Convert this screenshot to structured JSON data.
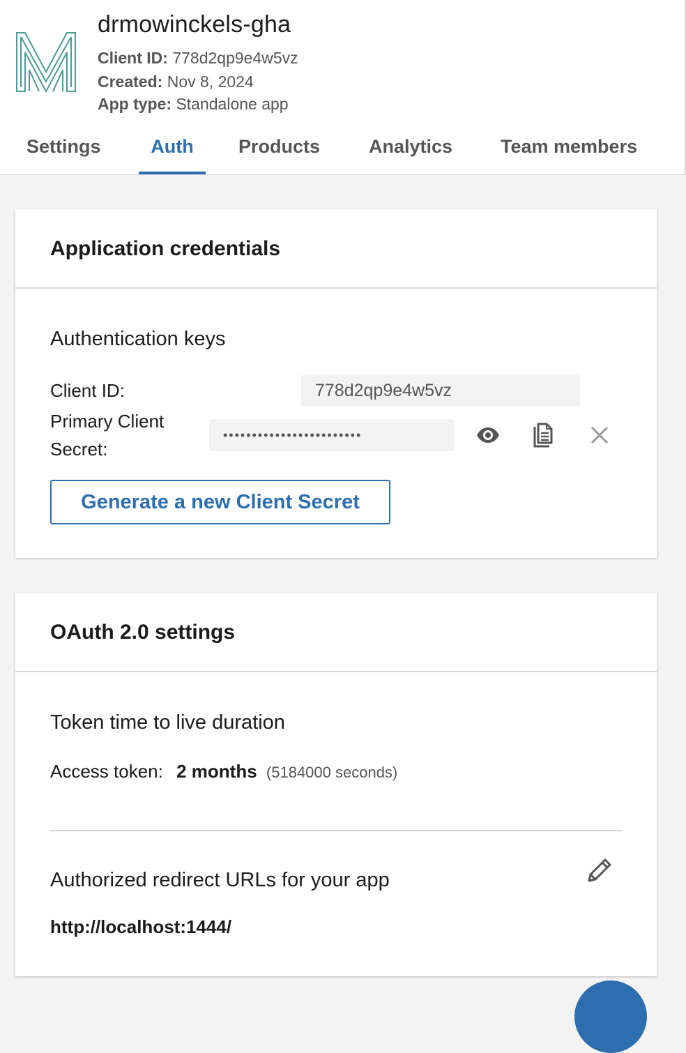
{
  "app": {
    "name": "drmowinckels-gha",
    "client_id_label": "Client ID:",
    "client_id_value": "778d2qp9e4w5vz",
    "created_label": "Created:",
    "created_value": "Nov 8, 2024",
    "app_type_label": "App type:",
    "app_type_value": "Standalone app"
  },
  "tabs": [
    {
      "label": "Settings",
      "active": false
    },
    {
      "label": "Auth",
      "active": true
    },
    {
      "label": "Products",
      "active": false
    },
    {
      "label": "Analytics",
      "active": false
    },
    {
      "label": "Team members",
      "active": false
    }
  ],
  "credentials": {
    "title": "Application credentials",
    "subtitle": "Authentication keys",
    "client_id_label": "Client ID:",
    "client_id_value": "778d2qp9e4w5vz",
    "secret_label_line1": "Primary Client",
    "secret_label_line2": "Secret:",
    "secret_masked": "••••••••••••••••••••••••",
    "generate_button": "Generate a new Client Secret"
  },
  "oauth": {
    "title": "OAuth 2.0 settings",
    "ttl_heading": "Token time to live duration",
    "access_token_label": "Access token:",
    "access_token_value": "2 months",
    "access_token_seconds": "(5184000 seconds)",
    "redirect_heading": "Authorized redirect URLs for your app",
    "redirect_url": "http://localhost:1444/"
  },
  "colors": {
    "accent": "#2d6fae",
    "logo": "#4a9a96",
    "text": "#1b1b1b",
    "muted": "#555555"
  },
  "icons": {
    "logo": "m-logo-icon",
    "show_secret": "eye-icon",
    "copy_secret": "copy-icon",
    "delete_secret": "close-icon",
    "edit_redirects": "pencil-icon"
  }
}
